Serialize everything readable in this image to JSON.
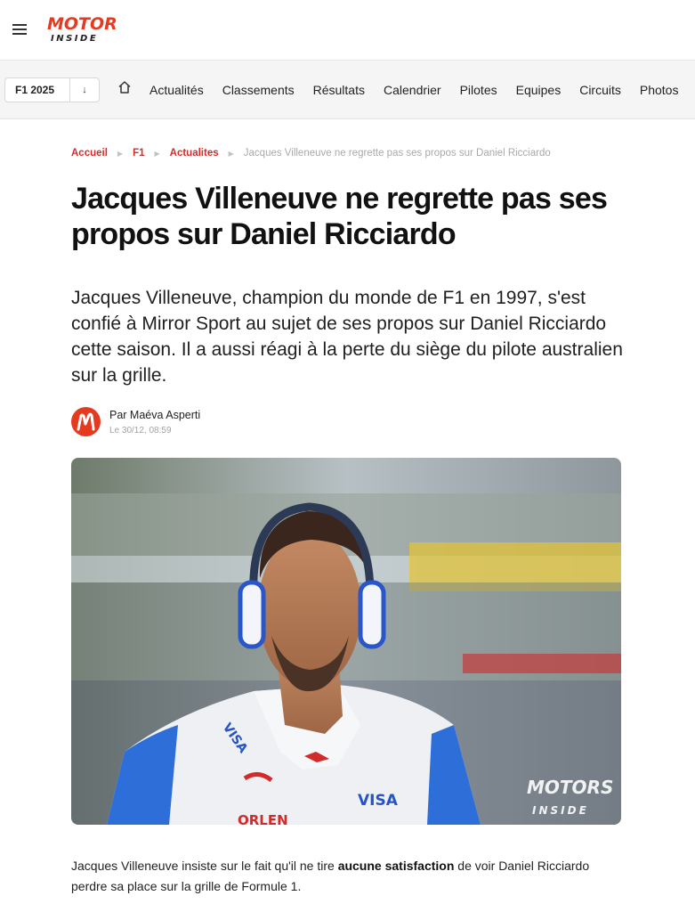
{
  "header": {
    "logo_top": "MOTORS",
    "logo_bottom": "INSIDE"
  },
  "nav": {
    "season": "F1 2025",
    "season_arrow": "↓",
    "items": [
      "Actualités",
      "Classements",
      "Résultats",
      "Calendrier",
      "Pilotes",
      "Equipes",
      "Circuits",
      "Photos"
    ]
  },
  "breadcrumb": {
    "items": [
      "Accueil",
      "F1",
      "Actualites"
    ],
    "current": "Jacques Villeneuve ne regrette pas ses propos sur Daniel Ricciardo"
  },
  "article": {
    "title": "Jacques Villeneuve ne regrette pas ses propos sur Daniel Ricciardo",
    "lead": "Jacques Villeneuve, champion du monde de F1 en 1997, s'est confié à Mirror Sport au sujet de ses propos sur Daniel Ricciardo cette saison. Il a aussi réagi à la perte du siège du pilote australien sur la grille.",
    "author": "Par Maéva Asperti",
    "date": "Le 30/12, 08:59",
    "body_before": "Jacques Villeneuve insiste sur le fait qu'il ne tire ",
    "body_bold": "aucune satisfaction",
    "body_after": " de voir Daniel Ricciardo perdre sa place sur la grille de Formule 1."
  },
  "hero_image": {
    "watermark_top": "MOTORS",
    "watermark_bottom": "INSIDE",
    "suit_text_left": "VISA",
    "suit_text_right": "VISA",
    "suit_text_bottom": "ORLEN"
  },
  "colors": {
    "brand": "#d52b2b",
    "logo": "#e53a1f"
  },
  "icons": {
    "menu": "hamburger-menu-icon",
    "home": "home-icon",
    "avatar": "motors-inside-avatar-icon"
  }
}
